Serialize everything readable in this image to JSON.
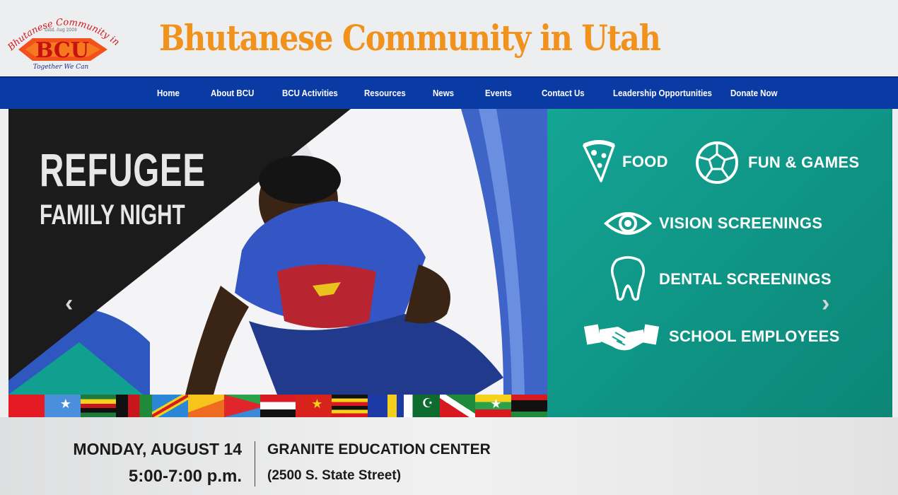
{
  "header": {
    "title": "Bhutanese Community in Utah",
    "logo": {
      "arc_text": "Bhutanese Community in Utah",
      "letters": "BCU",
      "tagline": "Together We Can",
      "est": "Estd. Aug 2009"
    }
  },
  "nav": {
    "items": [
      {
        "label": "Home"
      },
      {
        "label": "About BCU"
      },
      {
        "label": "BCU Activities"
      },
      {
        "label": "Resources"
      },
      {
        "label": "News"
      },
      {
        "label": "Events"
      },
      {
        "label": "Contact Us"
      },
      {
        "label": "Leadership Opportunities"
      },
      {
        "label": "Donate Now"
      }
    ]
  },
  "slide": {
    "headline_big": "REFUGEE",
    "headline_small": "FAMILY NIGHT",
    "features": [
      {
        "label": "FOOD",
        "icon": "pizza-slice-icon"
      },
      {
        "label": "FUN & GAMES",
        "icon": "soccer-ball-icon"
      },
      {
        "label": "VISION SCREENINGS",
        "icon": "eye-icon"
      },
      {
        "label": "DENTAL SCREENINGS",
        "icon": "tooth-icon"
      },
      {
        "label": "SCHOOL EMPLOYEES",
        "icon": "handshake-icon"
      }
    ],
    "prev_arrow": "‹",
    "next_arrow": "›",
    "teal_color": "#0f9484"
  },
  "event": {
    "date": "MONDAY, AUGUST 14",
    "time": "5:00-7:00 p.m.",
    "venue": "GRANITE EDUCATION CENTER",
    "address": "(2500 S. State Street)"
  },
  "colors": {
    "title_orange": "#f0921c",
    "nav_blue": "#0a3aa3"
  }
}
